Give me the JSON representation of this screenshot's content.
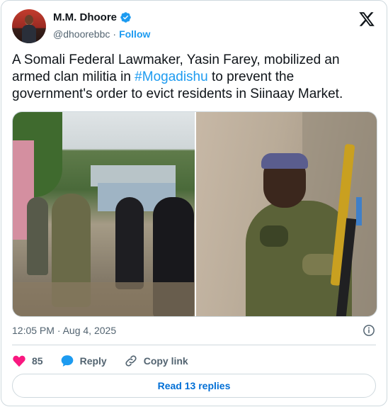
{
  "author": {
    "name": "M.M. Dhoore",
    "handle": "@dhoorebbc",
    "follow_label": "Follow"
  },
  "tweet": {
    "text_before": "A Somali Federal Lawmaker, Yasin Farey, mobilized an armed clan militia in ",
    "hashtag": "#Mogadishu",
    "text_after": " to prevent the government's order to evict residents in Siinaay Market."
  },
  "timestamp": "12:05 PM · Aug 4, 2025",
  "actions": {
    "likes_count": "85",
    "reply_label": "Reply",
    "copy_link_label": "Copy link"
  },
  "read_replies_label": "Read 13 replies",
  "colors": {
    "accent": "#1d9bf0",
    "like": "#f91880",
    "text": "#0f1419",
    "muted": "#536471",
    "border": "#cfd9de"
  },
  "icons": [
    "verified-badge-icon",
    "x-logo-icon",
    "info-icon",
    "heart-icon",
    "reply-bubble-icon",
    "link-icon"
  ]
}
